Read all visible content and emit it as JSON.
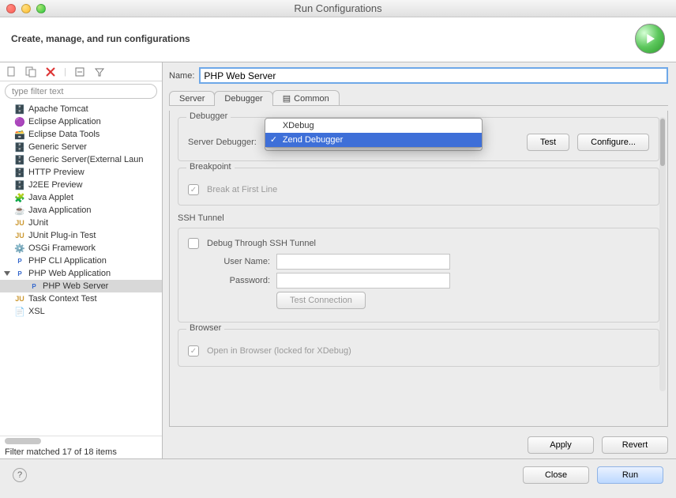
{
  "window": {
    "title": "Run Configurations"
  },
  "header": {
    "heading": "Create, manage, and run configurations"
  },
  "sidebar": {
    "filter_placeholder": "type filter text",
    "items": [
      {
        "label": "Apache Tomcat"
      },
      {
        "label": "Eclipse Application"
      },
      {
        "label": "Eclipse Data Tools"
      },
      {
        "label": "Generic Server"
      },
      {
        "label": "Generic Server(External Laun"
      },
      {
        "label": "HTTP Preview"
      },
      {
        "label": "J2EE Preview"
      },
      {
        "label": "Java Applet"
      },
      {
        "label": "Java Application"
      },
      {
        "label": "JUnit"
      },
      {
        "label": "JUnit Plug-in Test"
      },
      {
        "label": "OSGi Framework"
      },
      {
        "label": "PHP CLI Application"
      },
      {
        "label": "PHP Web Application"
      },
      {
        "label": "PHP Web Server"
      },
      {
        "label": "Task Context Test"
      },
      {
        "label": "XSL"
      }
    ],
    "status": "Filter matched 17 of 18 items"
  },
  "form": {
    "name_label": "Name:",
    "name_value": "PHP Web Server",
    "tabs": {
      "server": "Server",
      "debugger": "Debugger",
      "common": "Common"
    }
  },
  "debugger": {
    "group_label": "Debugger",
    "field_label": "Server Debugger:",
    "options": {
      "xdebug": "XDebug",
      "zend": "Zend Debugger"
    },
    "selected": "Zend Debugger",
    "test": "Test",
    "configure": "Configure..."
  },
  "breakpoint": {
    "group_label": "Breakpoint",
    "check_label": "Break at First Line"
  },
  "ssh": {
    "group_label": "SSH Tunnel",
    "check_label": "Debug Through SSH Tunnel",
    "username_label": "User Name:",
    "password_label": "Password:",
    "test_btn": "Test Connection"
  },
  "browser": {
    "group_label": "Browser",
    "check_label": "Open in Browser (locked for XDebug)"
  },
  "actions": {
    "apply": "Apply",
    "revert": "Revert",
    "close": "Close",
    "run": "Run"
  }
}
